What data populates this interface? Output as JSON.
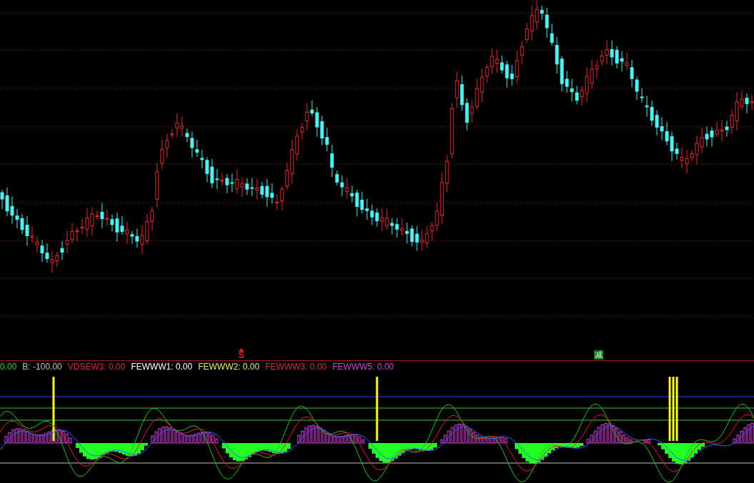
{
  "signals": [
    {
      "text": "S",
      "kind": "sell"
    },
    {
      "text": "减",
      "kind": "reduce"
    }
  ],
  "legend": [
    {
      "label": "0.00",
      "color": "#33cc33"
    },
    {
      "label": "B: -100.00",
      "color": "#c0c0c0"
    },
    {
      "label": "VDSEW3: 0.00",
      "color": "#cc3333"
    },
    {
      "label": "FEWWW1: 0.00",
      "color": "#ffffff"
    },
    {
      "label": "FEWWW2: 0.00",
      "color": "#e8e860"
    },
    {
      "label": "FEWWW3: 0.00",
      "color": "#cc3333"
    },
    {
      "label": "FEWWW5: 0.00",
      "color": "#cc44cc"
    }
  ]
}
